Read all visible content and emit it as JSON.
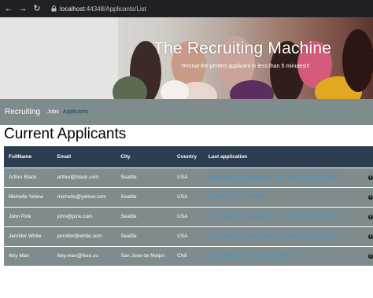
{
  "browser": {
    "back_icon": "arrow-left-icon",
    "forward_icon": "arrow-right-icon",
    "reload_icon": "reload-icon",
    "url_host": "localhost",
    "url_path": ":44348/Applicants/List"
  },
  "hero": {
    "title": "The Recruiting Machine",
    "subtitle": "Recruit the perfect applicant in less than 5 minutes!!!"
  },
  "navbar": {
    "brand": "Recruiting",
    "links": [
      "Jobs",
      "Applicants"
    ]
  },
  "page": {
    "title": "Current Applicants"
  },
  "table": {
    "headers": [
      "FullName",
      "Email",
      "City",
      "Country",
      "Last application"
    ],
    "rows": [
      {
        "name": "Arthur Black",
        "email": "arthur@black.com",
        "city": "Seattle",
        "country": "USA",
        "application": "Junior Back-End Developer - MIC_BACKEND_JNR_DEV"
      },
      {
        "name": "Michelle Yellow",
        "email": "michelle@yellow.com",
        "city": "Seattle",
        "country": "USA",
        "application": "Cashier - IKE_CASHIER"
      },
      {
        "name": "John Pink",
        "email": "john@pink.com",
        "city": "Seattle",
        "country": "USA",
        "application": "Senior Back-End Developer - MIC_BACKEND_SNR_DEV"
      },
      {
        "name": "Jennifer White",
        "email": "jennifer@white.com",
        "city": "Seattle",
        "country": "USA",
        "application": "Senior Back-End Developer - MIC_BACKEND_SNR_DEV"
      },
      {
        "name": "Ikky Man",
        "email": "ikky.man@ikea.su",
        "city": "San Jose de Maipo",
        "country": "Chili",
        "application": "Sales Manager - IKE_SALES_MNGR"
      }
    ],
    "info_icon": "info-icon"
  },
  "colors": {
    "navbar": "#7f8c8d",
    "table_header": "#2c3e50",
    "link": "#3498db"
  }
}
